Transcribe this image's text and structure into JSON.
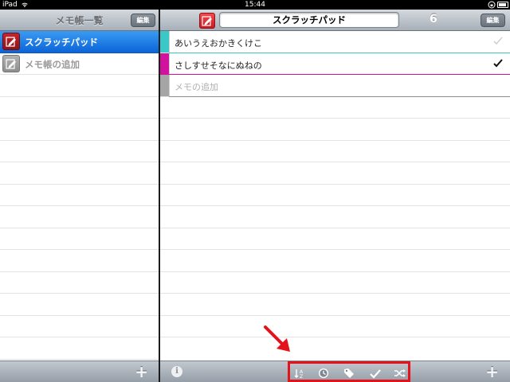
{
  "status_bar": {
    "carrier": "iPad",
    "time": "15:44"
  },
  "notebooks_pane": {
    "title": "メモ帳一覧",
    "edit_label": "編集",
    "items": [
      {
        "label": "スクラッチパッド",
        "icon": "notepad-icon",
        "selected": true
      },
      {
        "label": "メモ帳の追加",
        "icon": "add-notepad-icon",
        "selected": false
      }
    ],
    "add_label": "+"
  },
  "memo_pane": {
    "title": "スクラッチパッド",
    "count": "6",
    "edit_label": "編集",
    "memos": [
      {
        "text": "あいうえおかきくけこ",
        "color": "#3ac7c7",
        "checked": false
      },
      {
        "text": "さしすせそなにぬねの",
        "color": "#d0129e",
        "checked": true
      }
    ],
    "add_placeholder": "メモの追加",
    "toolbar": {
      "info_label": "i",
      "tools": [
        "sort-icon",
        "clock-icon",
        "tag-icon",
        "check-icon",
        "shuffle-icon"
      ],
      "add_label": "+"
    }
  },
  "colors": {
    "selection": "#1a78e6",
    "highlight": "#e3121b"
  }
}
